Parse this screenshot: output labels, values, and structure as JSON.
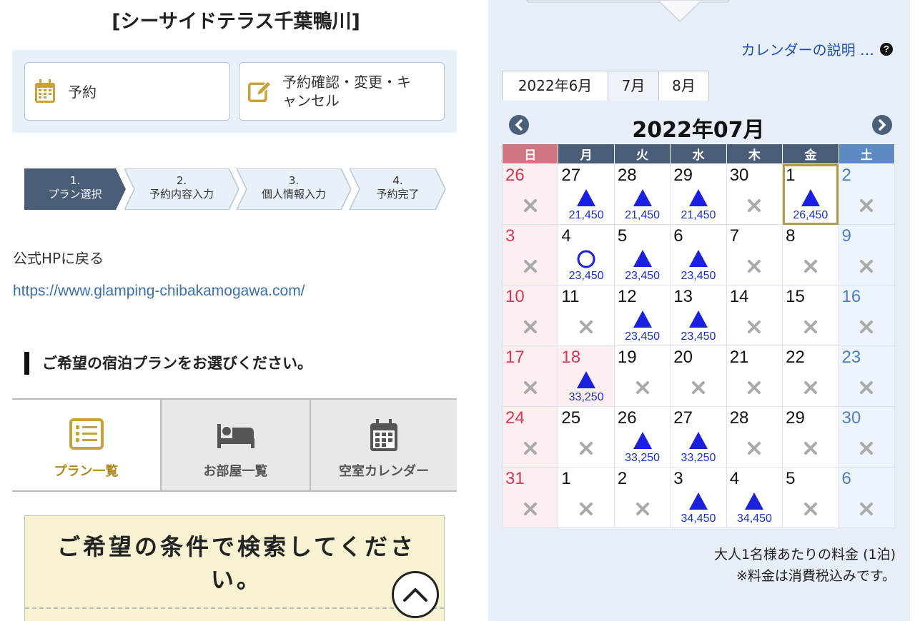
{
  "facility_title": "[シーサイドテラス千葉鴨川]",
  "quick_actions": {
    "reserve_label": "予約",
    "manage_label_line1": "予約確認・変更・キ",
    "manage_label_line2": "ャンセル"
  },
  "steps": [
    {
      "num": "1.",
      "label": "プラン選択",
      "active": true
    },
    {
      "num": "2.",
      "label": "予約内容入力"
    },
    {
      "num": "3.",
      "label": "個人情報入力"
    },
    {
      "num": "4.",
      "label": "予約完了"
    }
  ],
  "homepage": {
    "label": "公式HPに戻る",
    "url": "https://www.glamping-chibakamogawa.com/"
  },
  "section_heading": "ご希望の宿泊プランをお選びください。",
  "view_tabs": [
    {
      "label": "プラン一覧",
      "icon": "list-icon",
      "active": true
    },
    {
      "label": "お部屋一覧",
      "icon": "bed-icon"
    },
    {
      "label": "空室カレンダー",
      "icon": "calendar-icon"
    }
  ],
  "search_box": {
    "title": "ご希望の条件で検索してください。"
  },
  "calendar": {
    "help_link": "カレンダーの説明 …",
    "help_icon": "question-circle-icon",
    "month_tabs": [
      "2022年6月",
      "7月",
      "8月"
    ],
    "title": "2022年07月",
    "weekdays": [
      "日",
      "月",
      "火",
      "水",
      "木",
      "金",
      "土"
    ],
    "weeks": [
      [
        {
          "d": "26",
          "s": "x"
        },
        {
          "d": "27",
          "s": "tri",
          "p": "21,450"
        },
        {
          "d": "28",
          "s": "tri",
          "p": "21,450"
        },
        {
          "d": "29",
          "s": "tri",
          "p": "21,450"
        },
        {
          "d": "30",
          "s": "x"
        },
        {
          "d": "1",
          "s": "tri",
          "p": "26,450",
          "today": true
        },
        {
          "d": "2",
          "s": "x"
        }
      ],
      [
        {
          "d": "3",
          "s": "x"
        },
        {
          "d": "4",
          "s": "circle",
          "p": "23,450"
        },
        {
          "d": "5",
          "s": "tri",
          "p": "23,450"
        },
        {
          "d": "6",
          "s": "tri",
          "p": "23,450"
        },
        {
          "d": "7",
          "s": "x"
        },
        {
          "d": "8",
          "s": "x"
        },
        {
          "d": "9",
          "s": "x"
        }
      ],
      [
        {
          "d": "10",
          "s": "x"
        },
        {
          "d": "11",
          "s": "x"
        },
        {
          "d": "12",
          "s": "tri",
          "p": "23,450"
        },
        {
          "d": "13",
          "s": "tri",
          "p": "23,450"
        },
        {
          "d": "14",
          "s": "x"
        },
        {
          "d": "15",
          "s": "x"
        },
        {
          "d": "16",
          "s": "x"
        }
      ],
      [
        {
          "d": "17",
          "s": "x"
        },
        {
          "d": "18",
          "s": "tri",
          "p": "33,250",
          "holiday": true
        },
        {
          "d": "19",
          "s": "x"
        },
        {
          "d": "20",
          "s": "x"
        },
        {
          "d": "21",
          "s": "x"
        },
        {
          "d": "22",
          "s": "x"
        },
        {
          "d": "23",
          "s": "x"
        }
      ],
      [
        {
          "d": "24",
          "s": "x"
        },
        {
          "d": "25",
          "s": "x"
        },
        {
          "d": "26",
          "s": "tri",
          "p": "33,250"
        },
        {
          "d": "27",
          "s": "tri",
          "p": "33,250"
        },
        {
          "d": "28",
          "s": "x"
        },
        {
          "d": "29",
          "s": "x"
        },
        {
          "d": "30",
          "s": "x"
        }
      ],
      [
        {
          "d": "31",
          "s": "x"
        },
        {
          "d": "1",
          "s": "x"
        },
        {
          "d": "2",
          "s": "x"
        },
        {
          "d": "3",
          "s": "tri",
          "p": "34,450"
        },
        {
          "d": "4",
          "s": "tri",
          "p": "34,450"
        },
        {
          "d": "5",
          "s": "x"
        },
        {
          "d": "6",
          "s": "x"
        }
      ]
    ],
    "note_price": "大人1名様あたりの料金 (1泊)",
    "note_tax": "※料金は消費税込みです。"
  },
  "colors": {
    "accent_gold": "#b08a20",
    "step_active": "#4a5d78",
    "available_blue": "#1a2fcc",
    "sunday_red": "#d23a55",
    "saturday_blue": "#4a7fc0"
  }
}
